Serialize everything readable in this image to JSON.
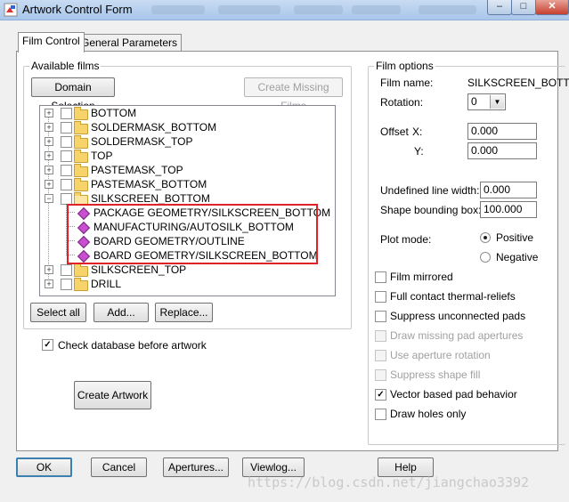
{
  "window": {
    "title": "Artwork Control Form",
    "buttons": {
      "minimize": "–",
      "maximize": "□",
      "close": "✕"
    }
  },
  "tabs": [
    {
      "label": "Film Control",
      "active": true
    },
    {
      "label": "General Parameters",
      "active": false
    }
  ],
  "available_films": {
    "legend": "Available films",
    "domain_selection": "Domain Selection",
    "create_missing_films": "Create Missing Films",
    "tree": [
      {
        "label": "BOTTOM",
        "type": "folder",
        "expanded": false
      },
      {
        "label": "SOLDERMASK_BOTTOM",
        "type": "folder",
        "expanded": false
      },
      {
        "label": "SOLDERMASK_TOP",
        "type": "folder",
        "expanded": false
      },
      {
        "label": "TOP",
        "type": "folder",
        "expanded": false
      },
      {
        "label": "PASTEMASK_TOP",
        "type": "folder",
        "expanded": false
      },
      {
        "label": "PASTEMASK_BOTTOM",
        "type": "folder",
        "expanded": false
      },
      {
        "label": "SILKSCREEN_BOTTOM",
        "type": "folder",
        "expanded": true
      },
      {
        "label": "PACKAGE GEOMETRY/SILKSCREEN_BOTTOM",
        "type": "layer"
      },
      {
        "label": "MANUFACTURING/AUTOSILK_BOTTOM",
        "type": "layer"
      },
      {
        "label": "BOARD GEOMETRY/OUTLINE",
        "type": "layer"
      },
      {
        "label": "BOARD GEOMETRY/SILKSCREEN_BOTTOM",
        "type": "layer"
      },
      {
        "label": "SILKSCREEN_TOP",
        "type": "folder",
        "expanded": false
      },
      {
        "label": "DRILL",
        "type": "folder",
        "expanded": false
      }
    ],
    "select_all": "Select all",
    "add": "Add...",
    "replace": "Replace..."
  },
  "check_database": {
    "label": "Check database before artwork",
    "checked": true
  },
  "create_artwork": "Create Artwork",
  "film_options": {
    "legend": "Film options",
    "film_name_label": "Film name:",
    "film_name_value": "SILKSCREEN_BOTTO",
    "rotation_label": "Rotation:",
    "rotation_value": "0",
    "offset_label": "Offset",
    "x_label": "X:",
    "x_value": "0.000",
    "y_label": "Y:",
    "y_value": "0.000",
    "undefined_line_width_label": "Undefined line width:",
    "undefined_line_width_value": "0.000",
    "shape_bounding_box_label": "Shape bounding box:",
    "shape_bounding_box_value": "100.000",
    "plot_mode_label": "Plot mode:",
    "plot_positive": "Positive",
    "plot_negative": "Negative",
    "plot_mode_selected": "Positive",
    "checkboxes": [
      {
        "label": "Film mirrored",
        "checked": false,
        "enabled": true
      },
      {
        "label": "Full contact thermal-reliefs",
        "checked": false,
        "enabled": true
      },
      {
        "label": "Suppress unconnected pads",
        "checked": false,
        "enabled": true
      },
      {
        "label": "Draw missing pad apertures",
        "checked": false,
        "enabled": false
      },
      {
        "label": "Use aperture rotation",
        "checked": false,
        "enabled": false
      },
      {
        "label": "Suppress shape fill",
        "checked": false,
        "enabled": false
      },
      {
        "label": "Vector based pad behavior",
        "checked": true,
        "enabled": true
      },
      {
        "label": "Draw holes only",
        "checked": false,
        "enabled": true
      }
    ]
  },
  "footer": {
    "ok": "OK",
    "cancel": "Cancel",
    "apertures": "Apertures...",
    "viewlog": "Viewlog...",
    "help": "Help"
  },
  "watermark": "https://blog.csdn.net/jiangchao3392",
  "colors": {
    "highlight": "#e0212a",
    "folder": "#f6d36b",
    "layer_icon": "#c94fd0"
  }
}
